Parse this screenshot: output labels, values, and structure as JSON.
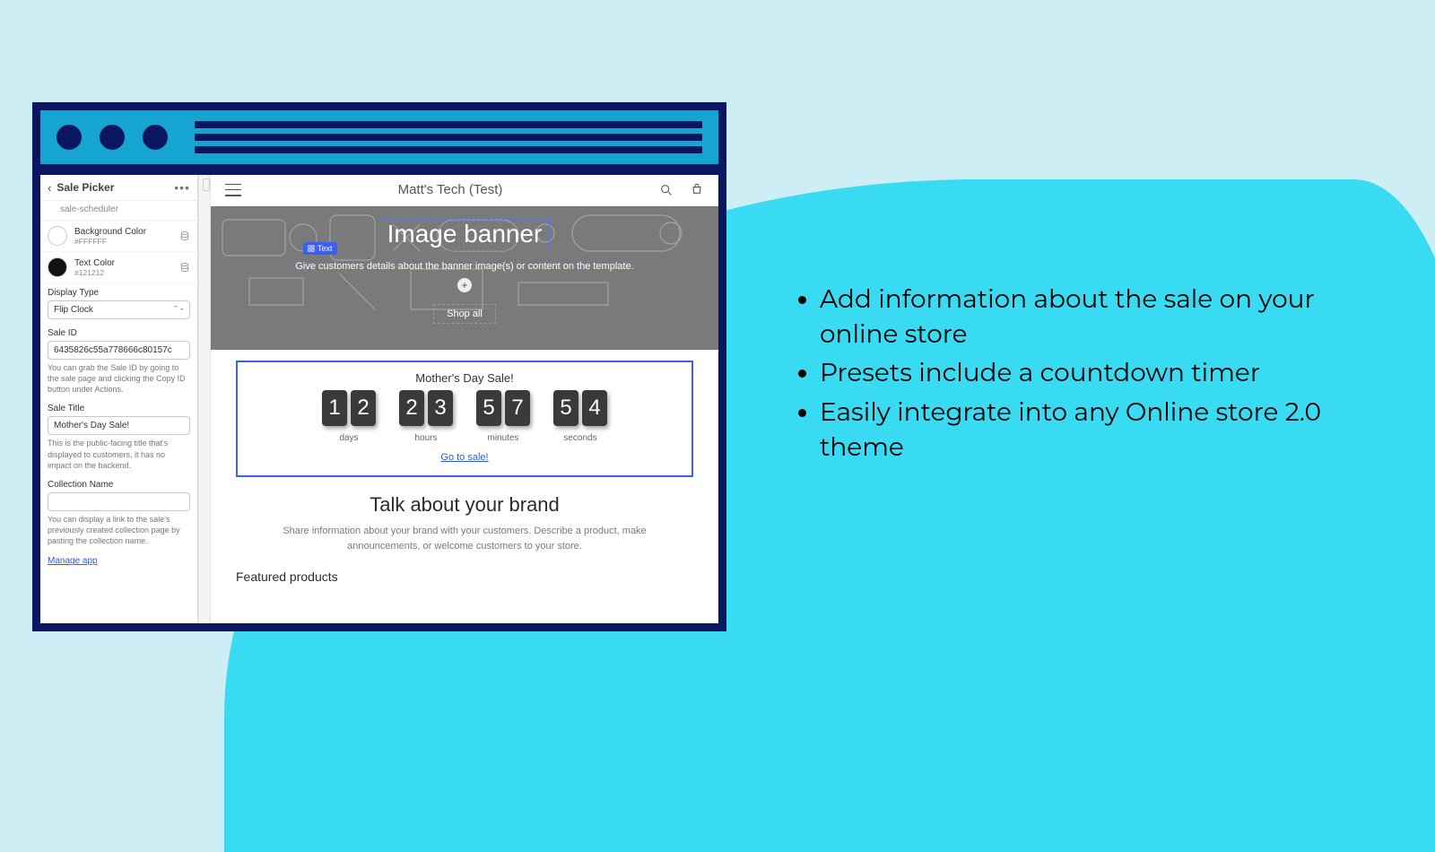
{
  "bullets": [
    "Add information about the sale on your online store",
    "Presets include a countdown timer",
    "Easily integrate into any Online store 2.0 theme"
  ],
  "sidebar": {
    "title": "Sale Picker",
    "subtitle": "sale-scheduler",
    "bg_color": {
      "label": "Background Color",
      "hex": "#FFFFFF"
    },
    "text_color": {
      "label": "Text Color",
      "hex": "#121212"
    },
    "display_type": {
      "label": "Display Type",
      "value": "Flip Clock"
    },
    "sale_id": {
      "label": "Sale ID",
      "value": "6435826c55a778666c80157c",
      "help": "You can grab the Sale ID by going to the sale page and clicking the Copy ID button under Actions."
    },
    "sale_title": {
      "label": "Sale Title",
      "value": "Mother's Day Sale!",
      "help": "This is the public-facing title that's displayed to customers, it has no impact on the backend."
    },
    "collection": {
      "label": "Collection Name",
      "value": "",
      "help": "You can display a link to the sale's previously created collection page by pasting the collection name."
    },
    "manage": "Manage app"
  },
  "preview": {
    "store_name": "Matt's Tech (Test)",
    "banner": {
      "heading": "Image banner",
      "tag": "Text",
      "sub": "Give customers details about the banner image(s) or content on the template.",
      "button": "Shop all"
    },
    "sale": {
      "title": "Mother's Day Sale!",
      "days": [
        "1",
        "2"
      ],
      "hours": [
        "2",
        "3"
      ],
      "minutes": [
        "5",
        "7"
      ],
      "seconds": [
        "5",
        "4"
      ],
      "units": {
        "d": "days",
        "h": "hours",
        "m": "minutes",
        "s": "seconds"
      },
      "link": "Go to sale!"
    },
    "brand": {
      "heading": "Talk about your brand",
      "body": "Share information about your brand with your customers. Describe a product, make announcements, or welcome customers to your store."
    },
    "featured": "Featured products"
  }
}
